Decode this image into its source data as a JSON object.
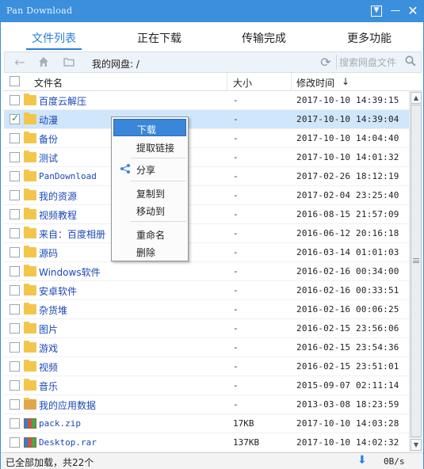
{
  "window": {
    "title": "Pan Download"
  },
  "tabs": [
    {
      "label": "文件列表",
      "active": true
    },
    {
      "label": "正在下载",
      "active": false
    },
    {
      "label": "传输完成",
      "active": false
    },
    {
      "label": "更多功能",
      "active": false
    }
  ],
  "toolbar": {
    "path": "我的网盘: /",
    "search_placeholder": "搜索网盘文件"
  },
  "columns": {
    "name": "文件名",
    "size": "大小",
    "modified": "修改时间",
    "sort_indicator": "↓"
  },
  "files": [
    {
      "name": "百度云解压",
      "size": "-",
      "modified": "2017-10-10 14:39:15",
      "icon": "folder-icon",
      "checked": false
    },
    {
      "name": "动漫",
      "size": "-",
      "modified": "2017-10-10 14:39:04",
      "icon": "folder-icon",
      "checked": true
    },
    {
      "name": "备份",
      "size": "-",
      "modified": "2017-10-10 14:04:40",
      "icon": "folder-icon",
      "checked": false
    },
    {
      "name": "测试",
      "size": "-",
      "modified": "2017-10-10 14:01:32",
      "icon": "folder-icon",
      "checked": false
    },
    {
      "name": "PanDownload",
      "size": "-",
      "modified": "2017-02-26 18:12:19",
      "icon": "folder-icon",
      "checked": false
    },
    {
      "name": "我的资源",
      "size": "-",
      "modified": "2017-02-04 23:25:40",
      "icon": "folder-icon",
      "checked": false
    },
    {
      "name": "视频教程",
      "size": "-",
      "modified": "2016-08-15 21:57:09",
      "icon": "folder-icon",
      "checked": false
    },
    {
      "name": "来自：百度相册",
      "size": "-",
      "modified": "2016-06-12 20:16:18",
      "icon": "folder-icon",
      "checked": false
    },
    {
      "name": "源码",
      "size": "-",
      "modified": "2016-03-14 01:01:03",
      "icon": "folder-icon",
      "checked": false
    },
    {
      "name": "Windows软件",
      "size": "-",
      "modified": "2016-02-16 00:34:00",
      "icon": "folder-icon",
      "checked": false
    },
    {
      "name": "安卓软件",
      "size": "-",
      "modified": "2016-02-16 00:33:51",
      "icon": "folder-icon",
      "checked": false
    },
    {
      "name": "杂货堆",
      "size": "-",
      "modified": "2016-02-16 00:06:25",
      "icon": "folder-icon",
      "checked": false
    },
    {
      "name": "图片",
      "size": "-",
      "modified": "2016-02-15 23:56:06",
      "icon": "folder-icon",
      "checked": false
    },
    {
      "name": "游戏",
      "size": "-",
      "modified": "2016-02-15 23:54:36",
      "icon": "folder-icon",
      "checked": false
    },
    {
      "name": "视频",
      "size": "-",
      "modified": "2016-02-15 23:51:01",
      "icon": "folder-icon",
      "checked": false
    },
    {
      "name": "音乐",
      "size": "-",
      "modified": "2015-09-07 02:11:14",
      "icon": "folder-icon",
      "checked": false
    },
    {
      "name": "我的应用数据",
      "size": "-",
      "modified": "2013-03-08 18:23:59",
      "icon": "app-folder-icon",
      "checked": false
    },
    {
      "name": "pack.zip",
      "size": "17KB",
      "modified": "2017-10-10 14:03:28",
      "icon": "archive-icon",
      "checked": false
    },
    {
      "name": "Desktop.rar",
      "size": "137KB",
      "modified": "2017-10-10 14:02:32",
      "icon": "archive-icon",
      "checked": false
    }
  ],
  "context_menu": {
    "items": [
      {
        "label": "下载",
        "highlighted": true
      },
      {
        "label": "提取链接"
      },
      {
        "label": "分享",
        "icon": "share-icon"
      },
      {
        "label": "复制到"
      },
      {
        "label": "移动到"
      },
      {
        "label": "重命名"
      },
      {
        "label": "删除"
      }
    ]
  },
  "status": {
    "text": "已全部加载，共22个",
    "speed": "0B/s"
  },
  "colors": {
    "accent": "#2a7ed3",
    "titlebar": "#3b8fdc",
    "selected_row": "#cfe6fb",
    "folder": "#f3c64b",
    "link": "#1a47b8"
  }
}
